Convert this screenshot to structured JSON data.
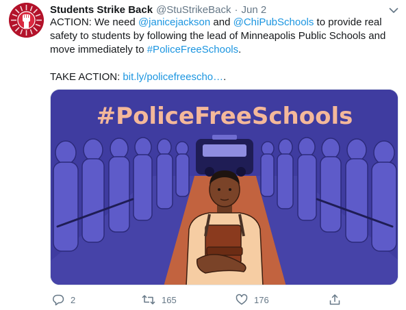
{
  "tweet": {
    "author": {
      "name": "Students Strike Back",
      "handle": "@StuStrikeBack",
      "separator": "·",
      "date": "Jun 2"
    },
    "text": {
      "l1_a": "ACTION: We need ",
      "l1_mention1": "@janicejackson",
      "l1_b": " and ",
      "l1_mention2": "@ChiPubSchools",
      "l1_c": " to provide real",
      "l2": "safety to students by following the lead of Minneapolis Public Schools and",
      "l3_a": "move immediately to ",
      "l3_hashtag": "#PoliceFreeSchools",
      "l3_b": ".",
      "l5_a": "TAKE ACTION: ",
      "l5_link": "bit.ly/policefreescho…",
      "l5_b": "."
    },
    "media": {
      "headline": "#PoliceFreeSchools"
    },
    "actions": {
      "reply_count": "2",
      "retweet_count": "165",
      "like_count": "176"
    }
  },
  "colors": {
    "link": "#1b95e0",
    "muted": "#657786",
    "avatar_red": "#b3122a",
    "media_purple": "#3f3ca0",
    "floor": "#c2633f",
    "headline": "#f4b89a"
  },
  "icons": [
    "caret-down-icon",
    "reply-icon",
    "retweet-icon",
    "like-icon",
    "share-icon"
  ]
}
